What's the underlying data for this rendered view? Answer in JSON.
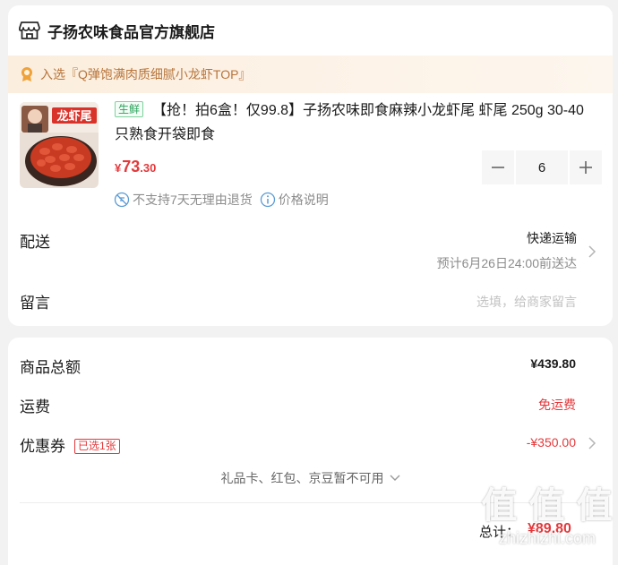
{
  "shop": {
    "icon": "store-icon",
    "name": "子扬农味食品官方旗舰店"
  },
  "rank_banner": {
    "icon": "ranking-medal-icon",
    "text": "入选『Q弹饱满肉质细腻小龙虾TOP』"
  },
  "product": {
    "image_alt": "龙虾尾 package image",
    "image_text": "龙虾尾",
    "tag": "生鲜",
    "title": "【抢！拍6盒！仅99.8】子扬农味即食麻辣小龙虾尾 虾尾 250g 30-40只熟食开袋即食",
    "price_symbol": "¥",
    "price_int": "73",
    "price_dec": ".30",
    "quantity": "6",
    "minus_label": "−",
    "plus_label": "+",
    "services": [
      {
        "icon": "no-return-icon",
        "text": "不支持7天无理由退货"
      },
      {
        "icon": "info-icon",
        "text": "价格说明"
      }
    ]
  },
  "shipping": {
    "label": "配送",
    "method": "快递运输",
    "eta": "预计6月26日24:00前送达"
  },
  "remark": {
    "label": "留言",
    "placeholder": "选填，给商家留言"
  },
  "summary": {
    "goods_label": "商品总额",
    "goods_value": "¥439.80",
    "freight_label": "运费",
    "freight_value": "免运费",
    "coupon_label": "优惠券",
    "coupon_badge": "已选1张",
    "coupon_value": "-¥350.00",
    "unavailable_text": "礼品卡、红包、京豆暂不可用",
    "total_label": "总计：",
    "total_value": "¥89.80"
  },
  "watermark": {
    "logo": "值 值 值",
    "url": "zhizhizhi.com"
  },
  "colors": {
    "accent_red": "#e4393c",
    "banner_text": "#b8743a",
    "fresh_green": "#2aa25a"
  }
}
